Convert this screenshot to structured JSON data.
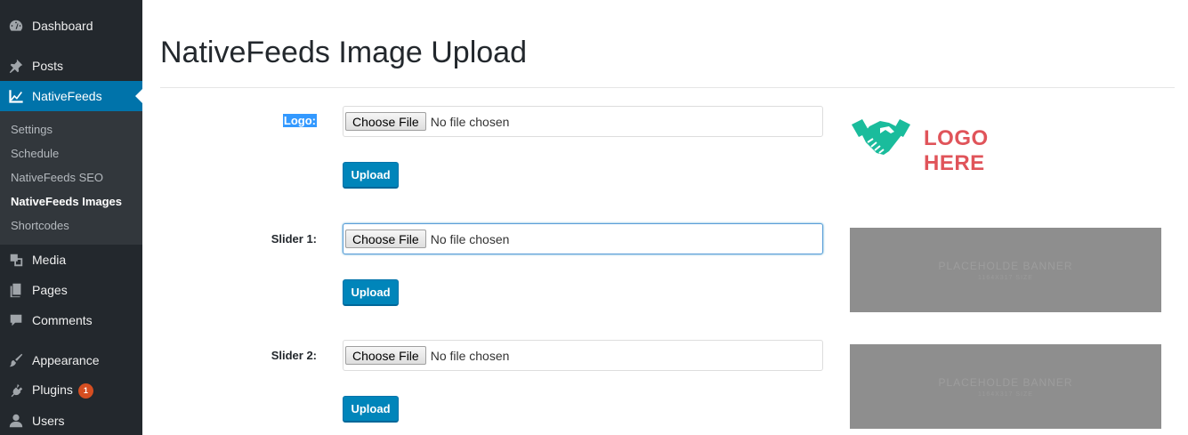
{
  "sidebar": {
    "items": [
      {
        "label": "Dashboard",
        "icon": "dashboard-icon"
      },
      {
        "label": "Posts",
        "icon": "pin-icon"
      },
      {
        "label": "NativeFeeds",
        "icon": "chart-line-icon",
        "active": true
      },
      {
        "label": "Media",
        "icon": "media-icon"
      },
      {
        "label": "Pages",
        "icon": "pages-icon"
      },
      {
        "label": "Comments",
        "icon": "comment-icon"
      },
      {
        "label": "Appearance",
        "icon": "brush-icon"
      },
      {
        "label": "Plugins",
        "icon": "plugin-icon",
        "badge": "1"
      },
      {
        "label": "Users",
        "icon": "user-icon"
      }
    ],
    "submenu": [
      {
        "label": "Settings"
      },
      {
        "label": "Schedule"
      },
      {
        "label": "NativeFeeds SEO"
      },
      {
        "label": "NativeFeeds Images",
        "current": true
      },
      {
        "label": "Shortcodes"
      }
    ]
  },
  "page": {
    "title": "NativeFeeds Image Upload"
  },
  "rows": [
    {
      "label": "Logo:",
      "choose_label": "Choose File",
      "file_status": "No file chosen",
      "upload_label": "Upload"
    },
    {
      "label": "Slider 1:",
      "choose_label": "Choose File",
      "file_status": "No file chosen",
      "upload_label": "Upload"
    },
    {
      "label": "Slider 2:",
      "choose_label": "Choose File",
      "file_status": "No file chosen",
      "upload_label": "Upload"
    }
  ],
  "previews": {
    "logo_text": "LOGO HERE",
    "banners": [
      {
        "title": "PLACEHOLDE BANNER",
        "subtitle": "1164X317 SIZE"
      },
      {
        "title": "PLACEHOLDE BANNER",
        "subtitle": "1164X317 SIZE"
      }
    ]
  },
  "colors": {
    "sidebar_bg": "#23282d",
    "submenu_bg": "#32373c",
    "active_bg": "#0073aa",
    "button_primary": "#0085ba",
    "badge": "#d54e21",
    "logo_teal": "#1abc9c",
    "logo_red": "#e0545a",
    "banner_gray": "#8e8e8e"
  }
}
